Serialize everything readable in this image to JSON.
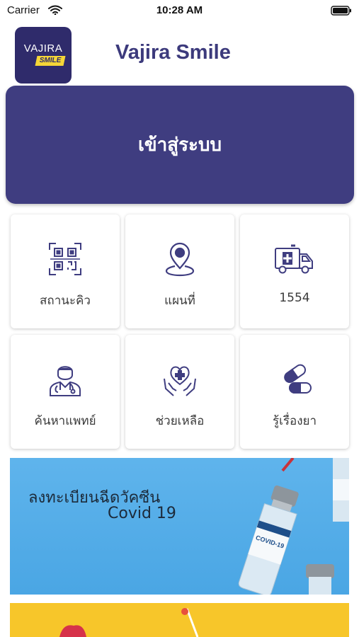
{
  "status_bar": {
    "carrier": "Carrier",
    "time": "10:28 AM",
    "icons": [
      "wifi-icon",
      "battery-icon"
    ]
  },
  "header": {
    "logo": {
      "main_text": "VAJIRA",
      "badge_text": "SMILE"
    },
    "title": "Vajira Smile"
  },
  "login": {
    "label": "เข้าสู่ระบบ"
  },
  "menu": [
    {
      "id": "queue-status",
      "label": "สถานะคิว",
      "icon": "qr-code-icon"
    },
    {
      "id": "map",
      "label": "แผนที่",
      "icon": "map-pin-icon"
    },
    {
      "id": "hotline",
      "label": "1554",
      "icon": "ambulance-icon"
    },
    {
      "id": "find-doctor",
      "label": "ค้นหาแพทย์",
      "icon": "doctor-icon"
    },
    {
      "id": "help",
      "label": "ช่วยเหลือ",
      "icon": "heart-hands-icon"
    },
    {
      "id": "drug-info",
      "label": "รู้เรื่องยา",
      "icon": "pill-icon"
    }
  ],
  "banners": {
    "vaccine": {
      "line1": "ลงทะเบียนฉีดวัคซีน",
      "line2": "Covid 19",
      "vial_label": "COVID-19"
    }
  },
  "colors": {
    "brand": "#3f3d80",
    "title": "#3c3a7c",
    "icon": "#3f3d80",
    "banner_blue": "#5fb4ec",
    "banner_yellow": "#f7c62a"
  }
}
